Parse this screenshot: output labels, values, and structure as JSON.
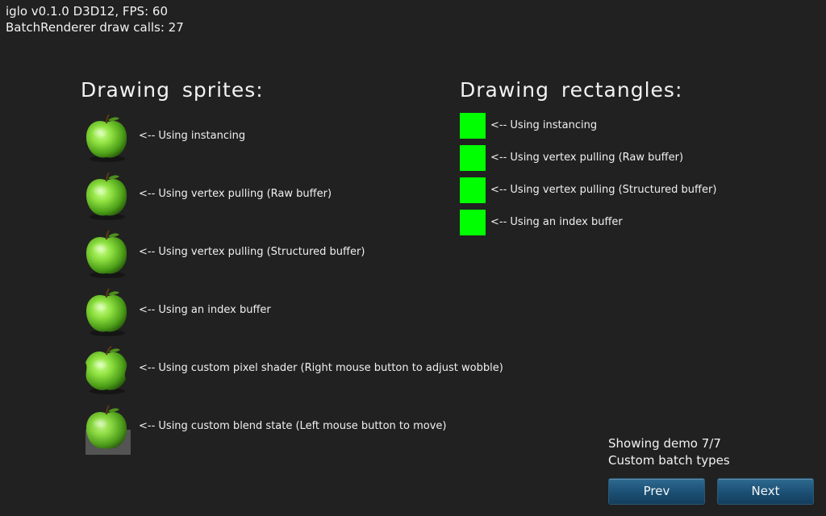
{
  "hud": {
    "version_line": "iglo v0.1.0 D3D12, FPS: 60",
    "draw_calls_line": "BatchRenderer draw calls: 27"
  },
  "sprites": {
    "heading": "Drawing sprites:",
    "rows": [
      {
        "label": "<-- Using instancing"
      },
      {
        "label": "<-- Using vertex pulling (Raw buffer)"
      },
      {
        "label": "<-- Using vertex pulling (Structured buffer)"
      },
      {
        "label": "<-- Using an index buffer"
      },
      {
        "label": "<-- Using custom pixel shader (Right mouse button to adjust wobble)"
      },
      {
        "label": "<-- Using custom blend state (Left mouse button to move)"
      }
    ]
  },
  "rectangles": {
    "heading": "Drawing rectangles:",
    "color": "#00ff00",
    "rows": [
      {
        "label": "<-- Using instancing"
      },
      {
        "label": "<-- Using vertex pulling (Raw buffer)"
      },
      {
        "label": "<-- Using vertex pulling (Structured buffer)"
      },
      {
        "label": "<-- Using an index buffer"
      }
    ]
  },
  "demo": {
    "showing": "Showing demo 7/7",
    "title": "Custom batch types",
    "prev_label": "Prev",
    "next_label": "Next"
  },
  "icons": {
    "apple": "apple-icon"
  }
}
